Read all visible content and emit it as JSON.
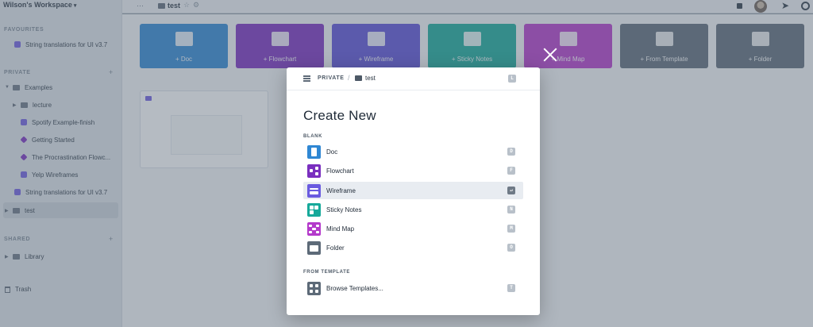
{
  "sidebar": {
    "workspace_title": "Wilson's Workspace",
    "favourites_label": "FAVOURITES",
    "private_label": "PRIVATE",
    "shared_label": "SHARED",
    "favourites": [
      {
        "label": "String translations for UI v3.7",
        "icon": "wireframe-icon"
      }
    ],
    "private_items": [
      {
        "label": "Examples",
        "icon": "folder-icon"
      },
      {
        "label": "lecture",
        "icon": "folder-icon"
      },
      {
        "label": "Spotify Example-finish",
        "icon": "wireframe-icon"
      },
      {
        "label": "Getting Started",
        "icon": "flowchart-icon"
      },
      {
        "label": "The Procrastination Flowc...",
        "icon": "flowchart-icon"
      },
      {
        "label": "Yelp Wireframes",
        "icon": "wireframe-icon"
      },
      {
        "label": "String translations for UI v3.7",
        "icon": "wireframe-icon"
      },
      {
        "label": "test",
        "icon": "folder-icon"
      }
    ],
    "shared_items": [
      {
        "label": "Library",
        "icon": "folder-icon"
      }
    ],
    "trash_label": "Trash"
  },
  "topbar": {
    "breadcrumb": "test",
    "more": "···"
  },
  "tiles": [
    {
      "label": "+ Doc",
      "color": "#2f87d3"
    },
    {
      "label": "+ Flowchart",
      "color": "#7a2fbf"
    },
    {
      "label": "+ Wireframe",
      "color": "#5b4fd8"
    },
    {
      "label": "+ Sticky Notes",
      "color": "#16a99a"
    },
    {
      "label": "+ Mind Map",
      "color": "#b43acb"
    },
    {
      "label": "+ From Template",
      "color": "#5d6a78"
    },
    {
      "label": "+ Folder",
      "color": "#5d6a78"
    }
  ],
  "modal": {
    "breadcrumb_root": "PRIVATE",
    "breadcrumb_sep": "/",
    "breadcrumb_folder": "test",
    "header_shortcut": "L",
    "title": "Create New",
    "blank_label": "BLANK",
    "template_label": "FROM TEMPLATE",
    "options": [
      {
        "label": "Doc",
        "shortcut": "D",
        "icon": "doc-icon",
        "color": "#2f87d3"
      },
      {
        "label": "Flowchart",
        "shortcut": "F",
        "icon": "flowchart-icon",
        "color": "#7a2fbf"
      },
      {
        "label": "Wireframe",
        "shortcut": "↵",
        "icon": "wireframe-icon",
        "color": "#6a5be0"
      },
      {
        "label": "Sticky Notes",
        "shortcut": "N",
        "icon": "sticky-notes-icon",
        "color": "#16a99a"
      },
      {
        "label": "Mind Map",
        "shortcut": "M",
        "icon": "mind-map-icon",
        "color": "#b43acb"
      },
      {
        "label": "Folder",
        "shortcut": "O",
        "icon": "folder-icon",
        "color": "#5d6a78"
      }
    ],
    "template_option": {
      "label": "Browse Templates...",
      "shortcut": "T",
      "icon": "templates-icon",
      "color": "#5d6a78"
    }
  }
}
